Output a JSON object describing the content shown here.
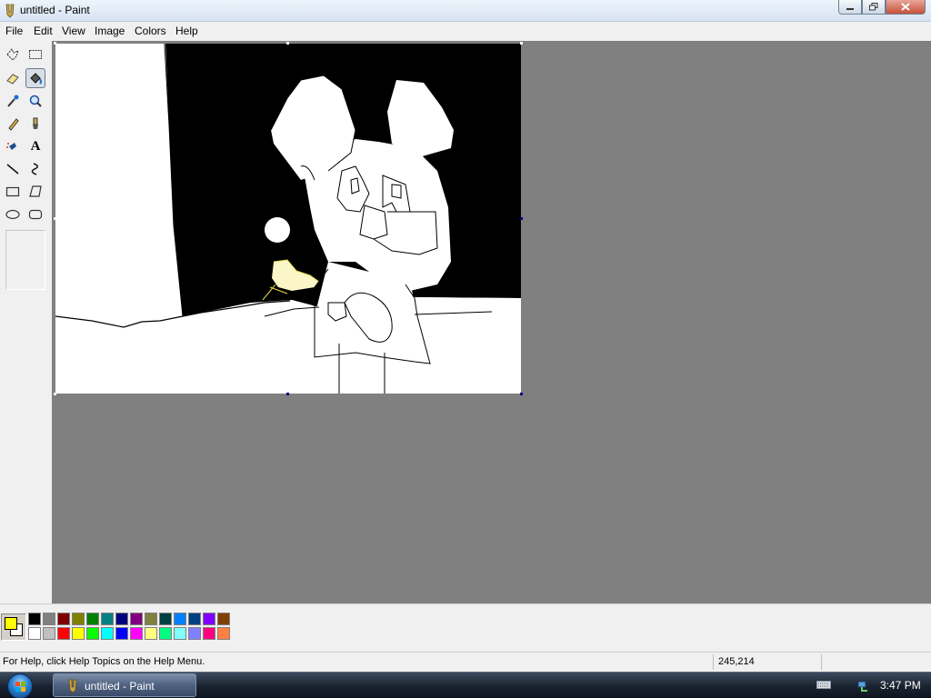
{
  "window": {
    "title": "untitled - Paint"
  },
  "menu": {
    "items": [
      "File",
      "Edit",
      "View",
      "Image",
      "Colors",
      "Help"
    ]
  },
  "toolbox": {
    "tools": [
      {
        "name": "free-form-select",
        "icon": "free-form-select-icon"
      },
      {
        "name": "select",
        "icon": "rect-select-icon"
      },
      {
        "name": "eraser",
        "icon": "eraser-icon"
      },
      {
        "name": "fill-with-color",
        "icon": "paint-bucket-icon",
        "active": true
      },
      {
        "name": "pick-color",
        "icon": "eyedropper-icon"
      },
      {
        "name": "magnifier",
        "icon": "magnifier-icon"
      },
      {
        "name": "pencil",
        "icon": "pencil-icon"
      },
      {
        "name": "brush",
        "icon": "brush-icon"
      },
      {
        "name": "airbrush",
        "icon": "airbrush-icon"
      },
      {
        "name": "text",
        "icon": "text-icon",
        "glyph": "A"
      },
      {
        "name": "line",
        "icon": "line-icon"
      },
      {
        "name": "curve",
        "icon": "curve-icon"
      },
      {
        "name": "rectangle",
        "icon": "rectangle-icon"
      },
      {
        "name": "polygon",
        "icon": "polygon-icon"
      },
      {
        "name": "ellipse",
        "icon": "ellipse-icon"
      },
      {
        "name": "rounded-rectangle",
        "icon": "rounded-rectangle-icon"
      }
    ]
  },
  "colors": {
    "primary": "#ffff00",
    "secondary": "#ffffff",
    "palette_top": [
      "#000000",
      "#808080",
      "#800000",
      "#808000",
      "#008000",
      "#008080",
      "#000080",
      "#800080",
      "#808040",
      "#004040",
      "#0080ff",
      "#004080",
      "#8000ff",
      "#804000"
    ],
    "palette_bottom": [
      "#ffffff",
      "#c0c0c0",
      "#ff0000",
      "#ffff00",
      "#00ff00",
      "#00ffff",
      "#0000ff",
      "#ff00ff",
      "#ffff80",
      "#00ff80",
      "#80ffff",
      "#8080ff",
      "#ff0080",
      "#ff8040"
    ]
  },
  "status": {
    "help_text": "For Help, click Help Topics on the Help Menu.",
    "coordinates": "245,214"
  },
  "taskbar": {
    "task_label": "untitled - Paint",
    "clock": "3:47 PM"
  }
}
